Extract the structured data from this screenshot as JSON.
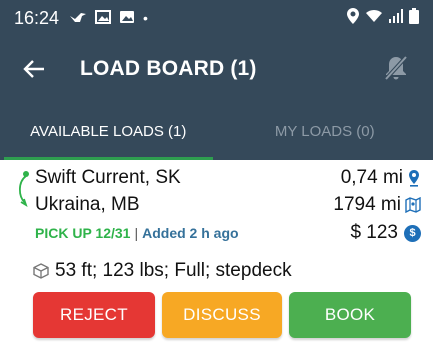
{
  "status_bar": {
    "time": "16:24",
    "dot": "•"
  },
  "header": {
    "title": "LOAD BOARD (1)"
  },
  "tabs": [
    {
      "label": "AVAILABLE LOADS (1)",
      "active": true
    },
    {
      "label": "MY LOADS (0)",
      "active": false
    }
  ],
  "load": {
    "origin": "Swift Current, SK",
    "origin_distance": "0,74 mi",
    "destination": "Ukraina, MB",
    "destination_distance": "1794 mi",
    "pickup": "PICK UP 12/31",
    "separator": "|",
    "added": "Added 2 h ago",
    "price": "$ 123",
    "details": "53 ft; 123 lbs; Full; stepdeck"
  },
  "actions": {
    "reject": "REJECT",
    "discuss": "DISCUSS",
    "book": "BOOK"
  },
  "colors": {
    "header_bg": "#35495a",
    "tab_indicator": "#2e9e4f",
    "pickup_green": "#2fb34a",
    "added_blue": "#35719a",
    "reject_red": "#e53734",
    "discuss_orange": "#f7a824",
    "book_green": "#4caf50"
  },
  "icons": [
    "bird-icon",
    "image-icon",
    "gallery-icon",
    "location-icon",
    "wifi-icon",
    "signal-icon",
    "battery-icon",
    "back-arrow-icon",
    "notifications-off-icon",
    "route-icon",
    "pin-icon",
    "map-icon",
    "dollar-coin-icon",
    "box-icon"
  ]
}
